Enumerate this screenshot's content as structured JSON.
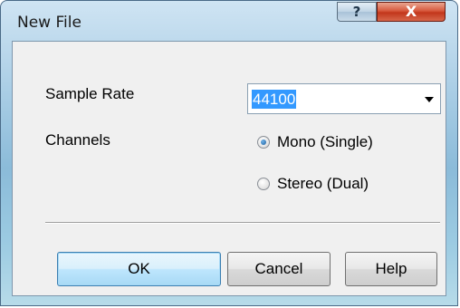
{
  "window": {
    "title": "New File",
    "help_glyph": "?",
    "close_glyph": "X"
  },
  "form": {
    "sample_rate_label": "Sample Rate",
    "sample_rate_value": "44100",
    "channels_label": "Channels",
    "channel_options": [
      {
        "label": "Mono (Single)",
        "selected": true
      },
      {
        "label": "Stereo (Dual)",
        "selected": false
      }
    ]
  },
  "buttons": {
    "ok": "OK",
    "cancel": "Cancel",
    "help": "Help"
  },
  "colors": {
    "selection": "#3399ff",
    "close_button": "#c2361b",
    "title_bar": "#a9cde5"
  }
}
